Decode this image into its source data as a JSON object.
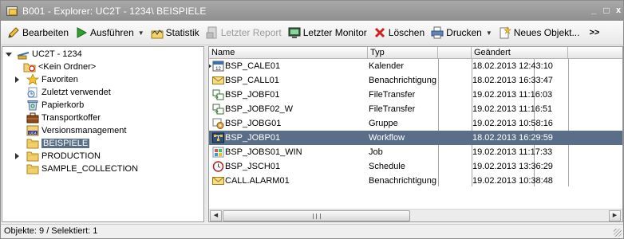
{
  "window": {
    "title": "B001 - Explorer: UC2T - 1234\\ BEISPIELE",
    "minimize": "_",
    "maximize": "□",
    "close": "x"
  },
  "toolbar": {
    "edit": "Bearbeiten",
    "run": "Ausführen",
    "statistic": "Statistik",
    "last_report": "Letzter Report",
    "last_monitor": "Letzter Monitor",
    "delete": "Löschen",
    "print": "Drucken",
    "new_object": "Neues Objekt...",
    "more": ">>"
  },
  "tree": {
    "root": "UC2T - 1234",
    "items": [
      {
        "label": "<Kein Ordner>",
        "icon": "no-folder-icon"
      },
      {
        "label": "Favoriten",
        "icon": "star-icon"
      },
      {
        "label": "Zuletzt verwendet",
        "icon": "recent-icon"
      },
      {
        "label": "Papierkorb",
        "icon": "recycle-bin-icon"
      },
      {
        "label": "Transportkoffer",
        "icon": "suitcase-icon"
      },
      {
        "label": "Versionsmanagement",
        "icon": "version-icon"
      },
      {
        "label": "BEISPIELE",
        "icon": "folder-icon"
      },
      {
        "label": "PRODUCTION",
        "icon": "folder-icon"
      },
      {
        "label": "SAMPLE_COLLECTION",
        "icon": "folder-icon"
      }
    ]
  },
  "list": {
    "columns": [
      "Name",
      "Typ",
      "Geändert"
    ],
    "rows": [
      {
        "name": "BSP_CALE01",
        "type": "Kalender",
        "changed": "18.02.2013 12:43:10",
        "icon": "calendar-icon"
      },
      {
        "name": "BSP_CALL01",
        "type": "Benachrichtigung",
        "changed": "18.02.2013 16:33:47",
        "icon": "envelope-icon"
      },
      {
        "name": "BSP_JOBF01",
        "type": "FileTransfer",
        "changed": "19.02.2013 11:16:03",
        "icon": "filetransfer-icon"
      },
      {
        "name": "BSP_JOBF02_W",
        "type": "FileTransfer",
        "changed": "19.02.2013 11:16:51",
        "icon": "filetransfer-icon"
      },
      {
        "name": "BSP_JOBG01",
        "type": "Gruppe",
        "changed": "19.02.2013 10:58:16",
        "icon": "group-icon"
      },
      {
        "name": "BSP_JOBP01",
        "type": "Workflow",
        "changed": "18.02.2013 16:29:59",
        "icon": "workflow-icon"
      },
      {
        "name": "BSP_JOBS01_WIN",
        "type": "Job",
        "changed": "19.02.2013 11:17:33",
        "icon": "job-icon"
      },
      {
        "name": "BSP_JSCH01",
        "type": "Schedule",
        "changed": "19.02.2013 13:36:29",
        "icon": "schedule-icon"
      },
      {
        "name": "CALL.ALARM01",
        "type": "Benachrichtigung",
        "changed": "19.02.2013 10:38:48",
        "icon": "envelope-icon"
      }
    ]
  },
  "status": {
    "text": "Objekte: 9  / Selektiert: 1"
  },
  "colors": {
    "selection": "#5a6f87",
    "titlebar": "#9a9a9a"
  }
}
